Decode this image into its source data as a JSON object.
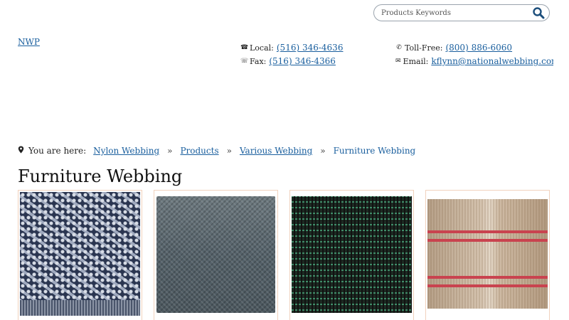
{
  "search": {
    "placeholder": "Products Keywords"
  },
  "header": {
    "logo_text": "NWP",
    "contact": {
      "local_label": "Local:",
      "local_value": "(516) 346-4636",
      "fax_label": "Fax:",
      "fax_value": "(516) 346-4366",
      "tollfree_label": "Toll-Free:",
      "tollfree_value": "(800) 886-6060",
      "email_label": "Email:",
      "email_value": "kflynn@nationalwebbing.com"
    }
  },
  "breadcrumb": {
    "prefix": "You are here:",
    "items": [
      "Nylon Webbing",
      "Products",
      "Various Webbing",
      "Furniture Webbing"
    ],
    "separator": "»"
  },
  "main": {
    "title": "Furniture Webbing"
  },
  "icons": {
    "search": "search-icon",
    "phone": "phone-icon",
    "fax": "fax-icon",
    "tollfree": "phone-circle-icon",
    "email": "envelope-icon",
    "location": "map-marker-icon"
  },
  "colors": {
    "link": "#1a5f9e",
    "card_border": "#f1d2bd"
  }
}
